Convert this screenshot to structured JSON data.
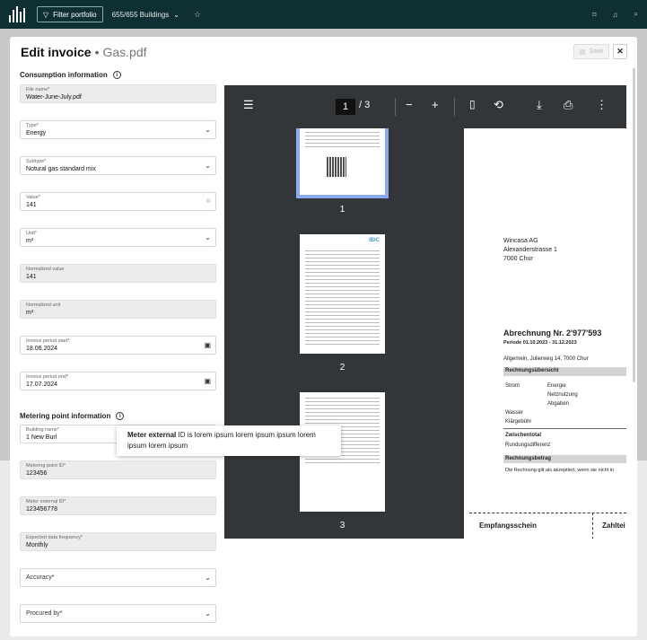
{
  "topbar": {
    "filter_label": "Filter portfolio",
    "buildings_count": "655/655 Buildings",
    "icons": [
      "bookmark-icon",
      "bell-icon",
      "search-icon"
    ]
  },
  "modal": {
    "title": "Edit invoice",
    "dot": "•",
    "filename": "Gas.pdf",
    "save_label": "Save",
    "close_label": "✕"
  },
  "consumption": {
    "heading": "Consumption information",
    "fields": {
      "file_name": {
        "label": "File name*",
        "value": "Water-June-July.pdf"
      },
      "type": {
        "label": "Type*",
        "value": "Energy"
      },
      "subtype": {
        "label": "Subtype*",
        "value": "Notural gas standard mix"
      },
      "value": {
        "label": "Value*",
        "value": "141"
      },
      "unit": {
        "label": "Unit*",
        "value": "m³"
      },
      "normalized_value": {
        "label": "Normalized value",
        "value": "141"
      },
      "normalized_unit": {
        "label": "Normalized unit",
        "value": "m³"
      },
      "period_start": {
        "label": "Invoice period start*",
        "value": "18.06.2024"
      },
      "period_end": {
        "label": "Invoice period end*",
        "value": "17.07.2024"
      }
    }
  },
  "metering": {
    "heading": "Metering point information",
    "fields": {
      "building_name": {
        "label": "Building name*",
        "value": "1 New Burl"
      },
      "metering_point_id": {
        "label": "Metering point ID*",
        "value": "123456"
      },
      "meter_external_id": {
        "label": "Meter external ID*",
        "value": "123456778"
      },
      "frequency": {
        "label": "Expected data frequency*",
        "value": "Monthly"
      },
      "accuracy": {
        "placeholder": "Accuracy*"
      },
      "procured_by": {
        "placeholder": "Procured by*"
      }
    }
  },
  "tooltip": {
    "bold": "Meter external",
    "text": " ID is lorem ipsum lorem ipsum ipsum lorem ipsum lorem ipsum"
  },
  "pdf": {
    "current_page": "1",
    "total": "/ 3",
    "thumb_labels": [
      "1",
      "2",
      "3"
    ],
    "thumb2_logo": "IBIC",
    "page": {
      "address": [
        "Wincasa AG",
        "Alexanderstrasse 1",
        "7000 Chur"
      ],
      "heading": "Abrechnung Nr. 2'977'593",
      "period": "Periode 01.10.2023 - 31.12.2023",
      "location": "Allgemein, Julierweg 14, 7000 Chur",
      "overview": "Rechnungsübersicht",
      "strom": "Strom",
      "energie": "Energie",
      "netznutzung": "Netznutzung",
      "abgaben": "Abgaben",
      "wasser": "Wasser",
      "klaer": "Klärgebühr",
      "zwischentotal": "Zwischentotal",
      "rundung": "Rundungsdifferenz",
      "betrag": "Rechnungsbetrag",
      "accepted": "Die Rechnung gilt als akzeptiert, wenn sie nicht in",
      "empfang": "Empfangsschein",
      "zahl": "Zahltei"
    }
  }
}
